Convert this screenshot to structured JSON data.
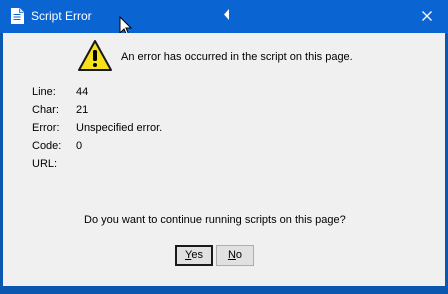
{
  "window": {
    "title": "Script Error",
    "title_icon": "document-icon",
    "close_icon": "close-icon",
    "titlebar_color": "#0a64d2"
  },
  "dialog": {
    "icon": "warning-icon",
    "message": "An error has occurred in the script on this page.",
    "details": [
      {
        "label": "Line:",
        "value": "44"
      },
      {
        "label": "Char:",
        "value": "21"
      },
      {
        "label": "Error:",
        "value": "Unspecified error."
      },
      {
        "label": "Code:",
        "value": "0"
      },
      {
        "label": "URL:",
        "value": ""
      }
    ],
    "question": "Do you want to continue running scripts on this page?"
  },
  "buttons": {
    "yes": {
      "mnemonic": "Y",
      "rest": "es"
    },
    "no": {
      "mnemonic": "N",
      "rest": "o"
    }
  }
}
